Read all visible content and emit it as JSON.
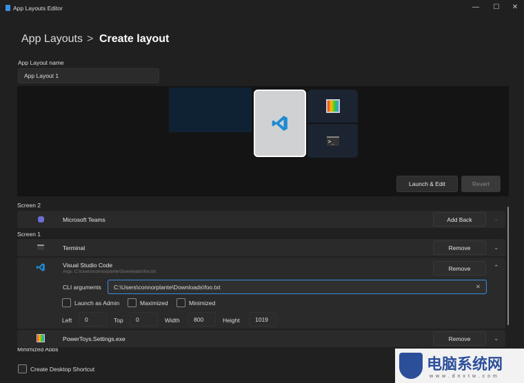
{
  "window": {
    "title": "App Layouts Editor",
    "minimize": "—",
    "maximize": "☐",
    "close": "✕"
  },
  "breadcrumb": {
    "parent": "App Layouts",
    "separator": ">",
    "current": "Create layout"
  },
  "name_field": {
    "label": "App Layout name",
    "value": "App Layout 1"
  },
  "preview": {
    "launch_edit": "Launch & Edit",
    "revert": "Revert"
  },
  "sections": {
    "screen2": "Screen 2",
    "screen1": "Screen 1",
    "minimized": "Minimized Apps"
  },
  "apps": {
    "teams": {
      "name": "Microsoft Teams",
      "action": "Add Back"
    },
    "terminal": {
      "name": "Terminal",
      "action": "Remove"
    },
    "vscode": {
      "name": "Visual Studio Code",
      "args": "Args: C:\\Users\\connorplante\\Downloads\\foo.txt",
      "action": "Remove",
      "cli_label": "CLI arguments",
      "cli_value": "C:\\Users\\connorplante\\Downloads\\foo.txt",
      "launch_admin": "Launch as Admin",
      "maximized": "Maximized",
      "minimized": "Minimized",
      "left_label": "Left",
      "left": "0",
      "top_label": "Top",
      "top": "0",
      "width_label": "Width",
      "width": "800",
      "height_label": "Height",
      "height": "1019"
    },
    "powertoys": {
      "name": "PowerToys.Settings.exe",
      "action": "Remove"
    }
  },
  "footer": {
    "shortcut": "Create Desktop Shortcut"
  },
  "watermark": {
    "text": "电脑系统网",
    "url": "www.dnxtw.com"
  },
  "colors": {
    "accent": "#3a8ee6",
    "vscode": "#1f8ad2"
  }
}
